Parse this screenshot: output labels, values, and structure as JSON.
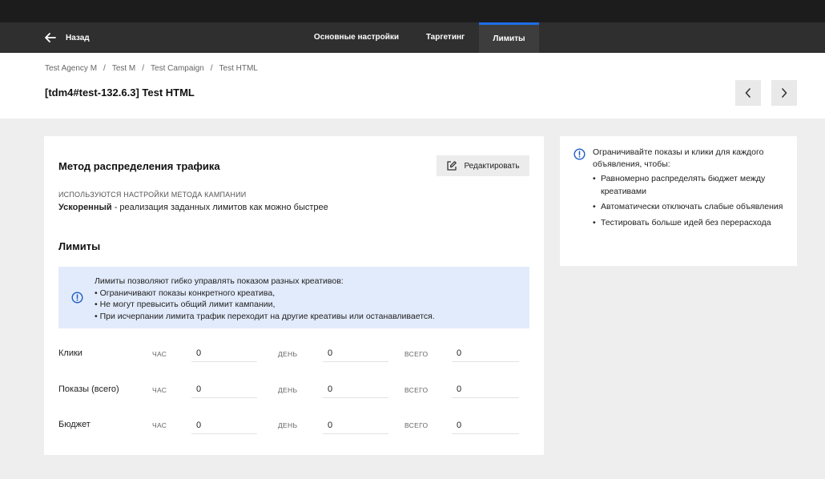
{
  "nav": {
    "back_label": "Назад",
    "tabs": [
      {
        "label": "Основные настройки"
      },
      {
        "label": "Таргетинг"
      },
      {
        "label": "Лимиты"
      }
    ],
    "active_tab": "Лимиты",
    "accent_color": "#1e6de8"
  },
  "breadcrumbs": [
    "Test Agency M",
    "Test M",
    "Test Campaign",
    "Test HTML"
  ],
  "page_title": "[tdm4#test-132.6.3] Test HTML",
  "traffic": {
    "title": "Метод распределения трафика",
    "edit_label": "Редактировать",
    "caption": "ИСПОЛЬЗУЮТСЯ НАСТРОЙКИ МЕТОДА КАМПАНИИ",
    "method_name": "Ускоренный",
    "method_desc": " - реализация заданных лимитов как можно быстрее"
  },
  "limits": {
    "title": "Лимиты",
    "info_lines": [
      "Лимиты позволяют гибко управлять показом разных креативов:",
      "• Ограничивают показы конкретного креатива,",
      "• Не могут превысить общий лимит кампании,",
      "• При исчерпании лимита трафик переходит на другие креативы или останавливается."
    ],
    "unit_labels": [
      "ЧАС",
      "ДЕНЬ",
      "ВСЕГО"
    ],
    "rows": [
      {
        "label": "Клики",
        "hour": "0",
        "day": "0",
        "total": "0"
      },
      {
        "label": "Показы (всего)",
        "hour": "0",
        "day": "0",
        "total": "0"
      },
      {
        "label": "Бюджет",
        "hour": "0",
        "day": "0",
        "total": "0"
      }
    ]
  },
  "side_info": {
    "lead": "Ограничивайте показы и клики для каждого объявления, чтобы:",
    "items": [
      "Равномерно распределять бюджет между креативами",
      "Автоматически отключать слабые объявления",
      "Тестировать больше идей без перерасхода"
    ]
  },
  "icons": {
    "back": "arrow-left-icon",
    "prev": "chevron-left-icon",
    "next": "chevron-right-icon",
    "edit": "edit-pencil-icon",
    "info": "info-circle-icon"
  }
}
